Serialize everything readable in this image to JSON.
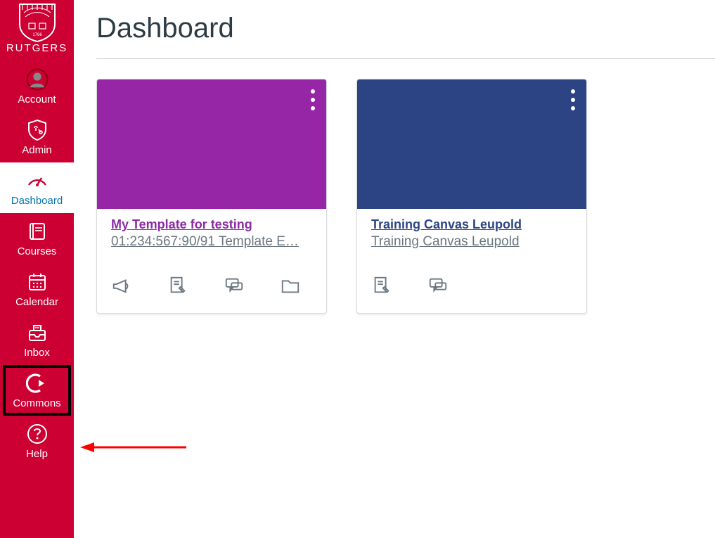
{
  "brand": {
    "name": "RUTGERS"
  },
  "nav": {
    "account": "Account",
    "admin": "Admin",
    "dashboard": "Dashboard",
    "courses": "Courses",
    "calendar": "Calendar",
    "inbox": "Inbox",
    "commons": "Commons",
    "help": "Help"
  },
  "page": {
    "title": "Dashboard"
  },
  "cards": [
    {
      "title": "My Template for testing",
      "subtitle": "01:234:567:90/91 Template E…",
      "colorClass": "purple"
    },
    {
      "title": "Training Canvas Leupold",
      "subtitle": "Training Canvas Leupold",
      "colorClass": "navy"
    }
  ]
}
